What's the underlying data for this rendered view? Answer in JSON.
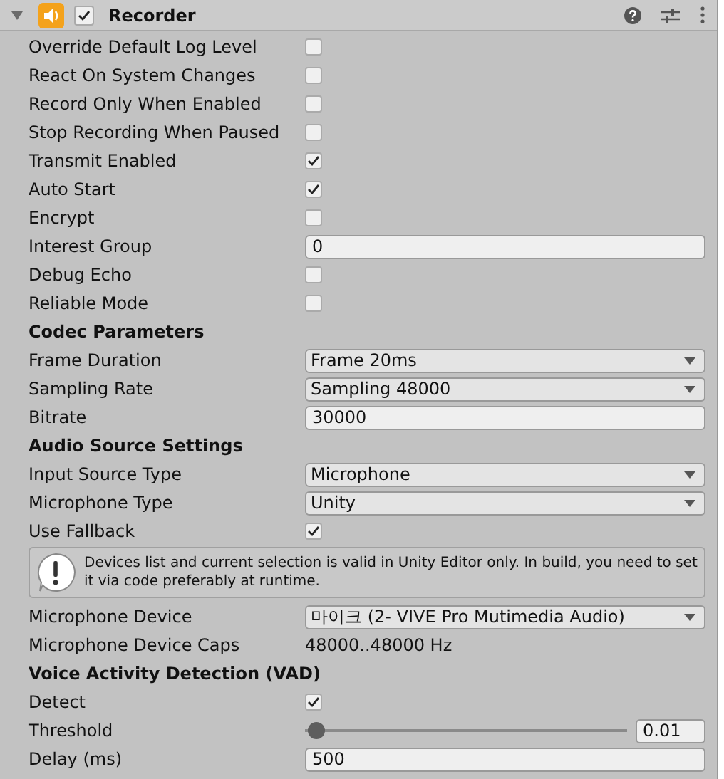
{
  "component": {
    "title": "Recorder",
    "enabled": true,
    "expanded": true
  },
  "rows": [
    {
      "kind": "toggle",
      "label": "Override Default Log Level",
      "checked": false
    },
    {
      "kind": "toggle",
      "label": "React On System Changes",
      "checked": false
    },
    {
      "kind": "toggle",
      "label": "Record Only When Enabled",
      "checked": false
    },
    {
      "kind": "toggle",
      "label": "Stop Recording When Paused",
      "checked": false
    },
    {
      "kind": "toggle",
      "label": "Transmit Enabled",
      "checked": true
    },
    {
      "kind": "toggle",
      "label": "Auto Start",
      "checked": true
    },
    {
      "kind": "toggle",
      "label": "Encrypt",
      "checked": false
    },
    {
      "kind": "text",
      "label": "Interest Group",
      "value": "0"
    },
    {
      "kind": "toggle",
      "label": "Debug Echo",
      "checked": false
    },
    {
      "kind": "toggle",
      "label": "Reliable Mode",
      "checked": false
    },
    {
      "kind": "header",
      "label": "Codec Parameters"
    },
    {
      "kind": "dropdown",
      "label": "Frame Duration",
      "value": "Frame 20ms"
    },
    {
      "kind": "dropdown",
      "label": "Sampling Rate",
      "value": "Sampling 48000"
    },
    {
      "kind": "text",
      "label": "Bitrate",
      "value": "30000"
    },
    {
      "kind": "header",
      "label": "Audio Source Settings"
    },
    {
      "kind": "dropdown",
      "label": "Input Source Type",
      "value": "Microphone"
    },
    {
      "kind": "dropdown",
      "label": "Microphone Type",
      "value": "Unity"
    },
    {
      "kind": "toggle",
      "label": "Use Fallback",
      "checked": true
    },
    {
      "kind": "help",
      "label": "Devices list and current selection is valid in Unity Editor only. In build, you need to set it via code preferably at runtime."
    },
    {
      "kind": "dropdown",
      "label": "Microphone Device",
      "value": "마이크 (2- VIVE Pro Mutimedia Audio)"
    },
    {
      "kind": "value",
      "label": "Microphone Device Caps",
      "value": "48000..48000 Hz"
    },
    {
      "kind": "header",
      "label": "Voice Activity Detection (VAD)"
    },
    {
      "kind": "toggle",
      "label": "Detect",
      "checked": true
    },
    {
      "kind": "slider",
      "label": "Threshold",
      "level": 0.01,
      "value": "0.01"
    },
    {
      "kind": "text",
      "label": "Delay (ms)",
      "value": "500"
    }
  ]
}
